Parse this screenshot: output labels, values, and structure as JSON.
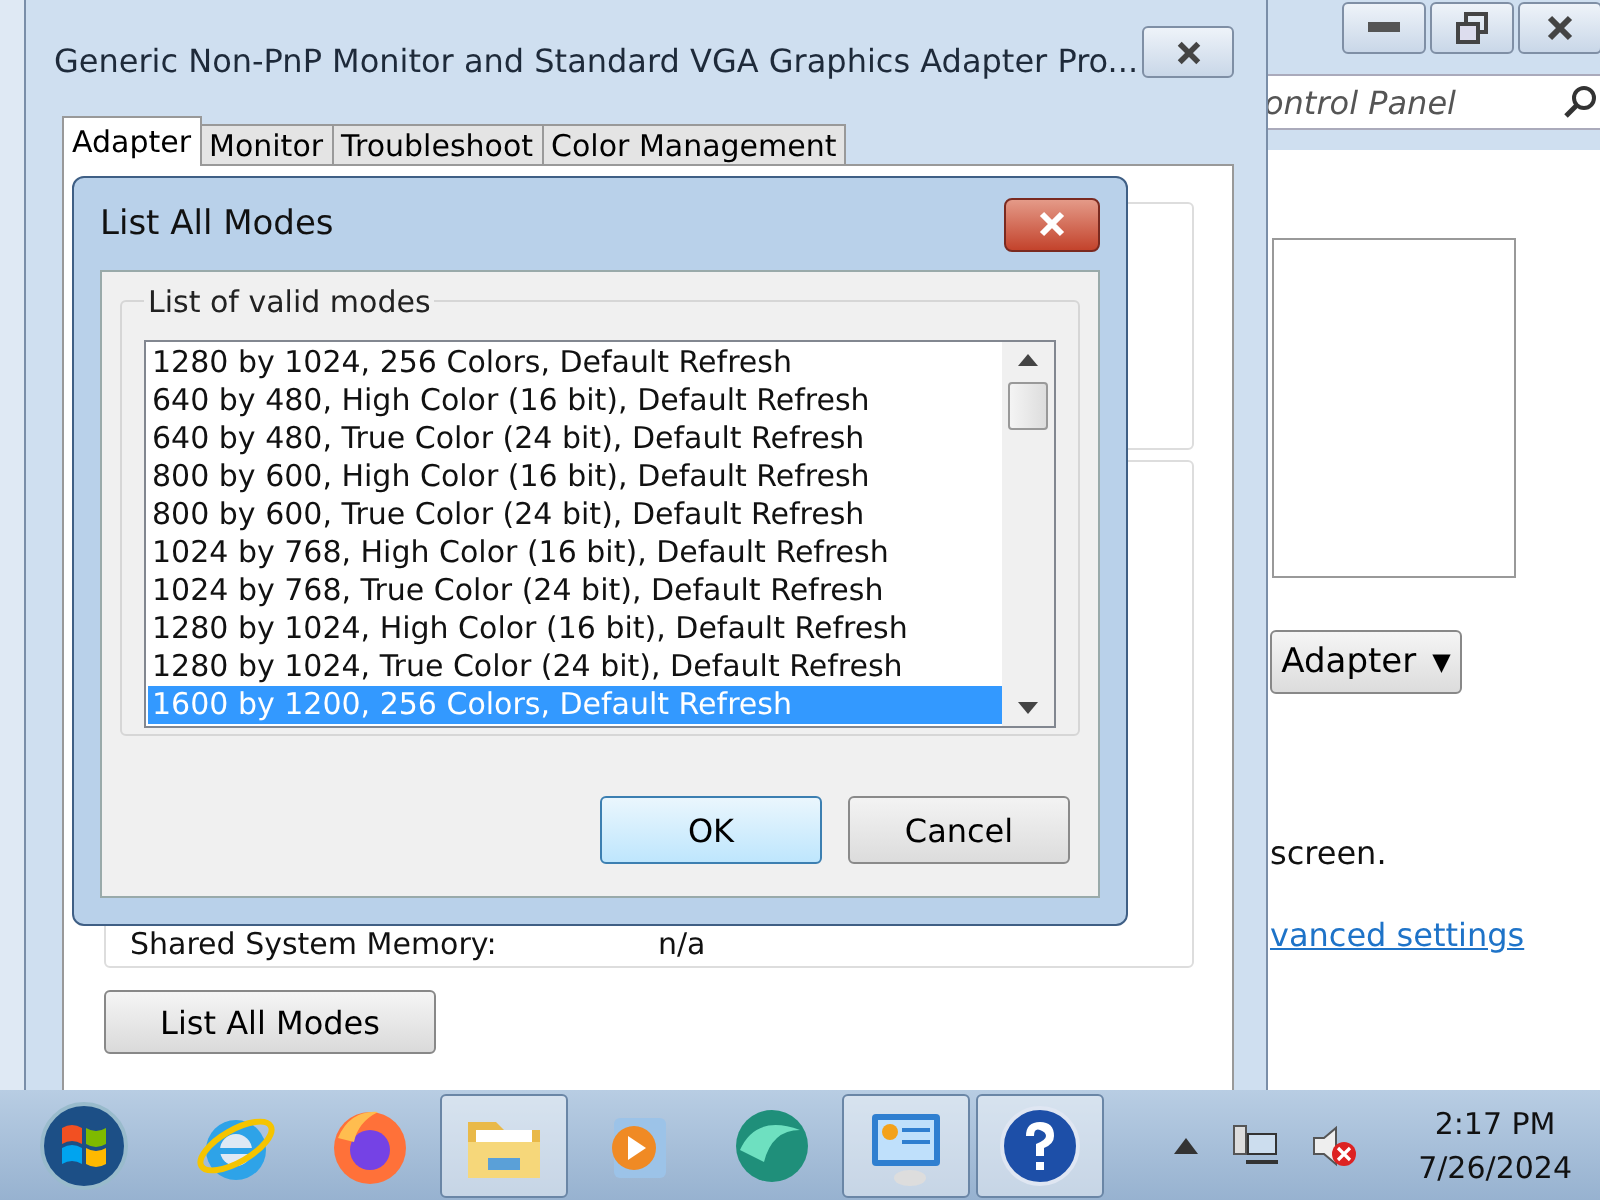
{
  "background_window": {
    "search": {
      "value": "ontrol Panel"
    },
    "adapter_button": {
      "label": "Adapter",
      "caret": "▼"
    },
    "text": "screen.",
    "link": "vanced settings"
  },
  "properties_window": {
    "title": "Generic Non-PnP Monitor and Standard VGA Graphics Adapter Pro...",
    "tabs": [
      {
        "label": "Adapter",
        "selected": true
      },
      {
        "label": "Monitor",
        "selected": false
      },
      {
        "label": "Troubleshoot",
        "selected": false
      },
      {
        "label": "Color Management",
        "selected": false
      }
    ],
    "info": [
      {
        "label": "Shared System Memory:",
        "value": "n/a"
      }
    ],
    "list_button": "List All Modes"
  },
  "dialog": {
    "title": "List All Modes",
    "group": "List of valid modes",
    "modes": [
      {
        "label": "1280 by 1024, 256 Colors, Default Refresh",
        "selected": false
      },
      {
        "label": "640 by 480, High Color (16 bit), Default Refresh",
        "selected": false
      },
      {
        "label": "640 by 480, True Color (24 bit), Default Refresh",
        "selected": false
      },
      {
        "label": "800 by 600, High Color (16 bit), Default Refresh",
        "selected": false
      },
      {
        "label": "800 by 600, True Color (24 bit), Default Refresh",
        "selected": false
      },
      {
        "label": "1024 by 768, High Color (16 bit), Default Refresh",
        "selected": false
      },
      {
        "label": "1024 by 768, True Color (24 bit), Default Refresh",
        "selected": false
      },
      {
        "label": "1280 by 1024, High Color (16 bit), Default Refresh",
        "selected": false
      },
      {
        "label": "1280 by 1024, True Color (24 bit), Default Refresh",
        "selected": false
      },
      {
        "label": "1600 by 1200, 256 Colors, Default Refresh",
        "selected": true
      }
    ],
    "buttons": [
      {
        "label": "OK",
        "kind": "default"
      },
      {
        "label": "Cancel",
        "kind": "normal"
      }
    ]
  },
  "taskbar": {
    "apps": [
      {
        "kind": "ie",
        "selected": false
      },
      {
        "kind": "firefox",
        "selected": false
      },
      {
        "kind": "folder",
        "selected": true
      },
      {
        "kind": "media",
        "selected": false
      },
      {
        "kind": "orb",
        "selected": false
      },
      {
        "kind": "panel",
        "selected": true
      },
      {
        "kind": "help",
        "selected": true
      }
    ],
    "time": "2:17 PM",
    "date": "7/26/2024"
  }
}
